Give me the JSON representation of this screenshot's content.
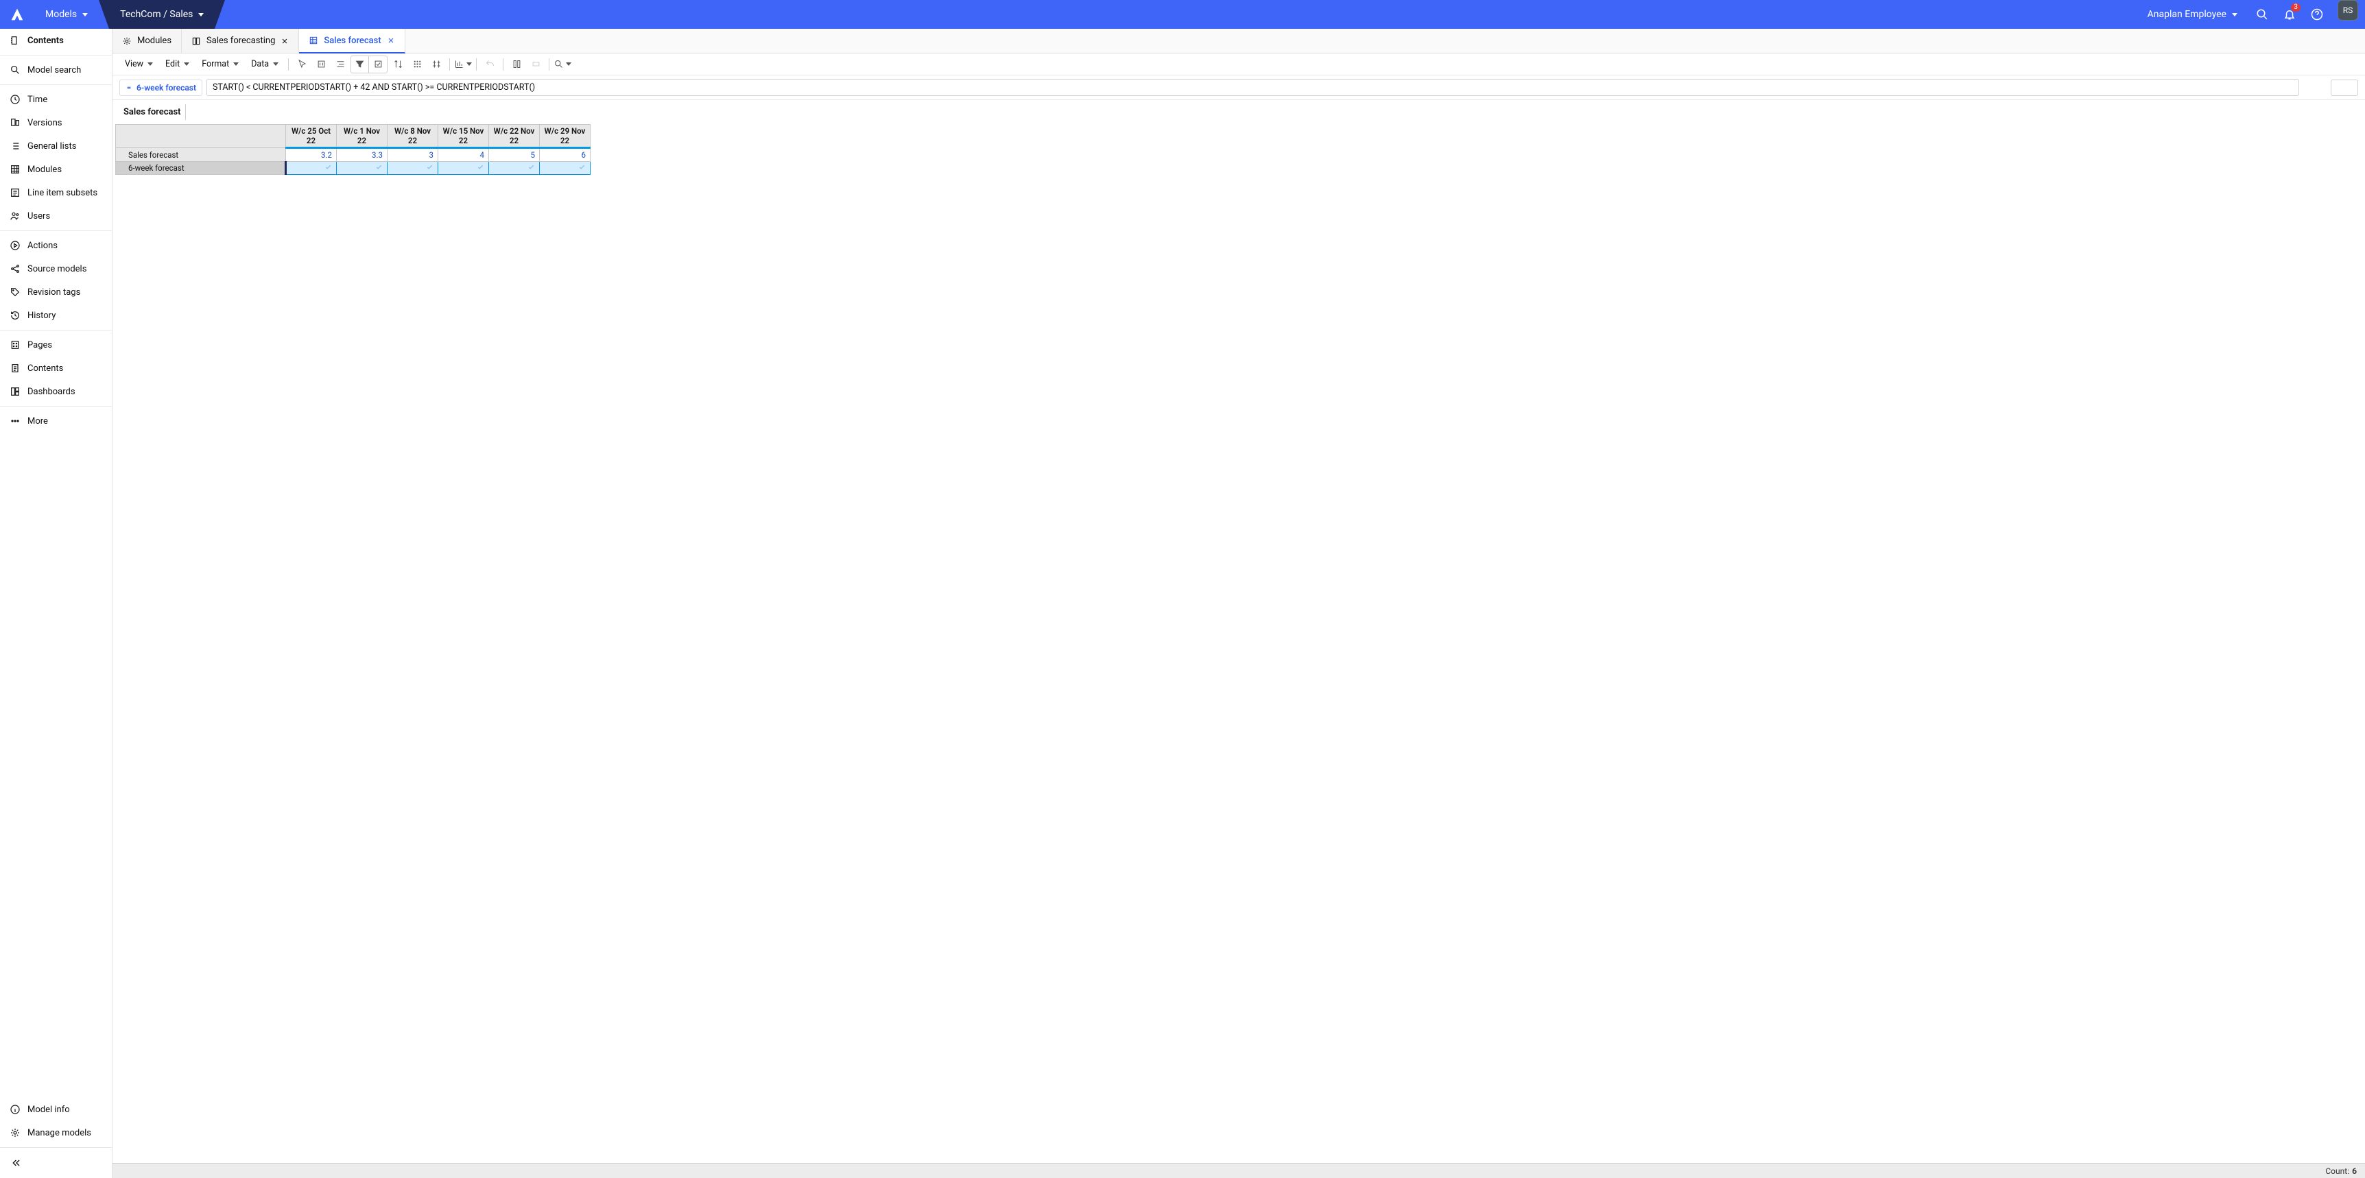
{
  "header": {
    "models_label": "Models",
    "workspace_label": "TechCom / Sales",
    "user_label": "Anaplan Employee",
    "notification_count": "3",
    "avatar_initials": "RS"
  },
  "sidebar": {
    "contents": "Contents",
    "model_search": "Model search",
    "time": "Time",
    "versions": "Versions",
    "general_lists": "General lists",
    "modules": "Modules",
    "line_item_subsets": "Line item subsets",
    "users": "Users",
    "actions": "Actions",
    "source_models": "Source models",
    "revision_tags": "Revision tags",
    "history": "History",
    "pages": "Pages",
    "contents2": "Contents",
    "dashboards": "Dashboards",
    "more": "More",
    "model_info": "Model info",
    "manage_models": "Manage models"
  },
  "tabs": {
    "t0": "Modules",
    "t1": "Sales forecasting",
    "t2": "Sales forecast"
  },
  "toolbar": {
    "view": "View",
    "edit": "Edit",
    "format": "Format",
    "data": "Data"
  },
  "formula": {
    "label": "6-week forecast",
    "value": "START() < CURRENTPERIODSTART() + 42 AND START() >= CURRENTPERIODSTART()"
  },
  "sheet": {
    "title": "Sales forecast",
    "columns": [
      "W/c 25 Oct 22",
      "W/c 1 Nov 22",
      "W/c 8 Nov 22",
      "W/c 15 Nov 22",
      "W/c 22 Nov 22",
      "W/c 29 Nov 22"
    ],
    "rows": {
      "r0": {
        "label": "Sales forecast",
        "cells": [
          "3.2",
          "3.3",
          "3",
          "4",
          "5",
          "6"
        ]
      },
      "r1": {
        "label": "6-week forecast"
      }
    }
  },
  "status": {
    "count_label": "Count:",
    "count_value": "6"
  }
}
